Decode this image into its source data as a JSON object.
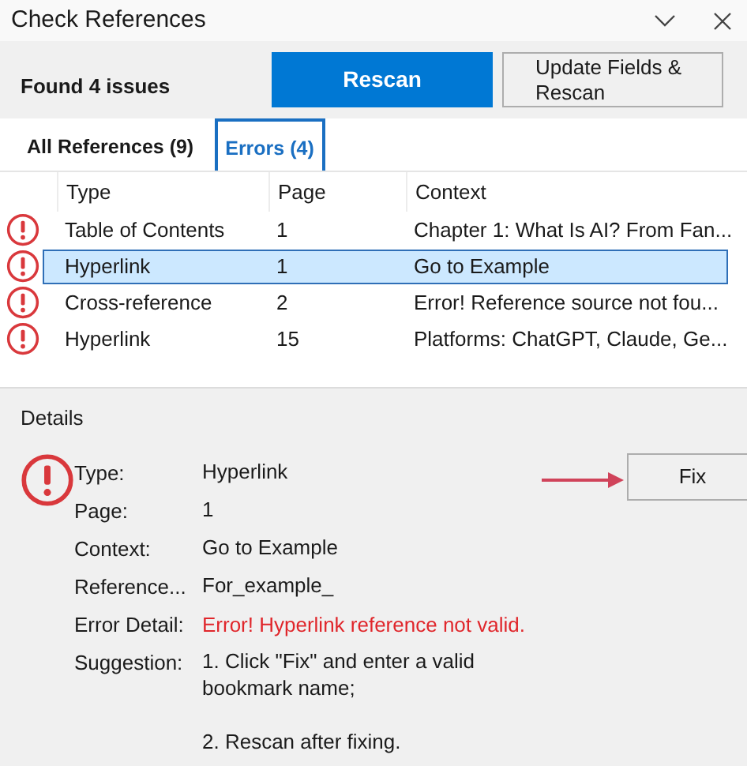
{
  "window": {
    "title": "Check References"
  },
  "toolbar": {
    "summary": "Found 4 issues",
    "buttons": [
      {
        "label": "Rescan",
        "kind": "primary"
      },
      {
        "label": "Update Fields & Rescan",
        "kind": "secondary"
      }
    ]
  },
  "tabs": [
    {
      "label": "All References (9)",
      "selected": false
    },
    {
      "label": "Errors (4)",
      "selected": true
    }
  ],
  "table": {
    "columns": [
      "Type",
      "Page",
      "Context"
    ],
    "rows": [
      {
        "type": "Table of Contents",
        "page": "1",
        "context": "Chapter 1: What Is AI? From Fan...",
        "selected": false
      },
      {
        "type": "Hyperlink",
        "page": "1",
        "context": "Go to Example",
        "selected": true
      },
      {
        "type": "Cross-reference",
        "page": "2",
        "context": "Error! Reference source not fou...",
        "selected": false
      },
      {
        "type": "Hyperlink",
        "page": "15",
        "context": "Platforms: ChatGPT, Claude, Ge...",
        "selected": false
      }
    ]
  },
  "details": {
    "title": "Details",
    "fix_button": "Fix",
    "fields": [
      {
        "label": "Type:",
        "kind": "text",
        "values": [
          "Hyperlink"
        ]
      },
      {
        "label": "Page:",
        "kind": "text",
        "values": [
          "1"
        ]
      },
      {
        "label": "Context:",
        "kind": "text",
        "values": [
          "Go to Example"
        ]
      },
      {
        "label": "Reference...",
        "kind": "text",
        "values": [
          "For_example_"
        ]
      },
      {
        "label": "Error Detail:",
        "kind": "error",
        "values": [
          "Error! Hyperlink reference not valid."
        ]
      },
      {
        "label": "Suggestion:",
        "kind": "text",
        "values": [
          "1. Click \"Fix\" and enter a valid bookmark name;",
          "2. Rescan after fixing."
        ]
      }
    ]
  }
}
